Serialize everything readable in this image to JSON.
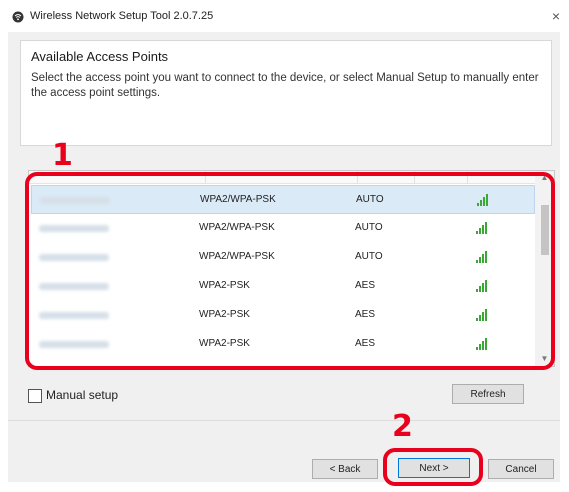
{
  "window": {
    "title": "Wireless Network Setup Tool 2.0.7.25",
    "close_glyph": "×"
  },
  "header": {
    "title": "Available Access Points",
    "description": "Select the access point you want to connect to the device, or select Manual Setup to manually enter the access point settings."
  },
  "access_points": [
    {
      "security": "WPA2/WPA-PSK",
      "encryption": "AUTO",
      "selected": true
    },
    {
      "security": "WPA2/WPA-PSK",
      "encryption": "AUTO",
      "selected": false
    },
    {
      "security": "WPA2/WPA-PSK",
      "encryption": "AUTO",
      "selected": false
    },
    {
      "security": "WPA2-PSK",
      "encryption": "AES",
      "selected": false
    },
    {
      "security": "WPA2-PSK",
      "encryption": "AES",
      "selected": false
    },
    {
      "security": "WPA2-PSK",
      "encryption": "AES",
      "selected": false
    }
  ],
  "manual_setup": {
    "label": "Manual setup",
    "checked": false
  },
  "buttons": {
    "refresh": "Refresh",
    "back": "< Back",
    "next": "Next >",
    "cancel": "Cancel"
  },
  "callouts": {
    "list": "1",
    "next": "2"
  },
  "colors": {
    "callout_red": "#e8001c",
    "selection": "#dbeaf7",
    "signal_green": "#3aa835"
  },
  "icons": {
    "scroll_up": "▲",
    "scroll_down": "▼"
  }
}
